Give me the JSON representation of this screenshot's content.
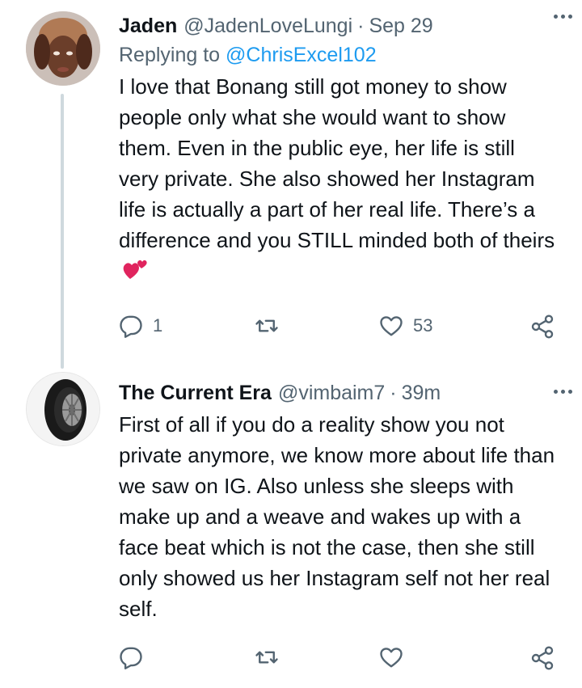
{
  "tweets": [
    {
      "name": "Jaden",
      "handle": "@JadenLoveLungi",
      "separator": "·",
      "time": "Sep 29",
      "replying_prefix": "Replying to",
      "replying_to": "@ChrisExcel102",
      "text": "I love that Bonang still got money to show people only what she would want to show them. Even in the public eye, her life is still very private. She also showed her Instagram life is actually a part of her real life. There’s a difference and you STILL minded both of theirs",
      "emoji": "two-hearts",
      "reply_count": "1",
      "retweet_count": "",
      "like_count": "53"
    },
    {
      "name": "The Current Era",
      "handle": "@vimbaim7",
      "separator": "·",
      "time": "39m",
      "text": "First of all if you do a reality show you not private anymore, we know more about life than we saw on IG. Also unless she sleeps with make up and a weave and wakes up with a face beat which is not the case, then she still only showed us her Instagram self not her real self.",
      "reply_count": "",
      "retweet_count": "",
      "like_count": ""
    }
  ],
  "colors": {
    "text": "#0f1419",
    "secondary": "#536471",
    "link": "#1d9bf0",
    "thread_line": "#cfd9de",
    "emoji_heart": "#e0245e"
  },
  "icons": [
    "reply-icon",
    "retweet-icon",
    "like-icon",
    "share-icon",
    "more-icon"
  ]
}
